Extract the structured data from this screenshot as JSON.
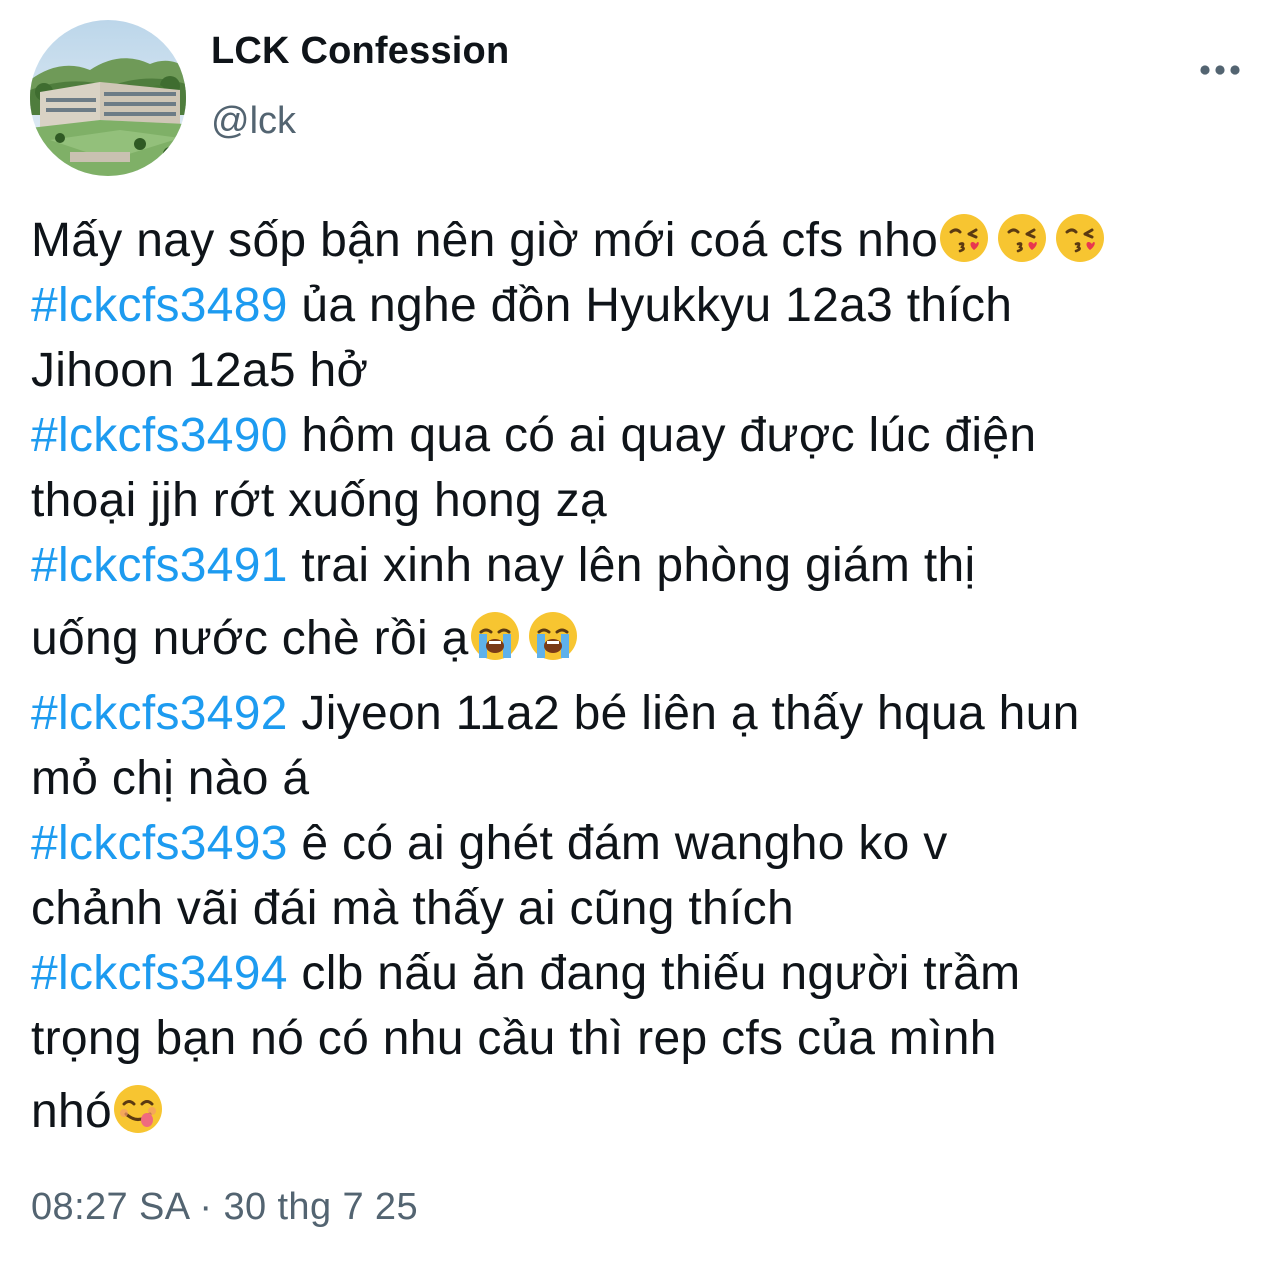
{
  "author": {
    "display_name": "LCK Confession",
    "handle": "@lck",
    "avatar_icon": "school-building-avatar"
  },
  "menu": {
    "icon": "more-horizontal-icon"
  },
  "tweet": {
    "intro": "Mấy nay sốp bận nên giờ mới coá cfs nho",
    "intro_emojis": [
      "face-blowing-kiss-emoji",
      "face-blowing-kiss-emoji",
      "face-blowing-kiss-emoji"
    ],
    "confessions": [
      {
        "tag": "#lckcfs3489",
        "line1": " ủa nghe đồn Hyukkyu 12a3 thích",
        "line2": "Jihoon 12a5 hở"
      },
      {
        "tag": "#lckcfs3490",
        "line1": " hôm qua có ai quay được lúc điện",
        "line2": "thoại jjh rớt xuống hong zạ"
      },
      {
        "tag": "#lckcfs3491",
        "line1": " trai xinh nay lên phòng giám thị",
        "line2": "uống nước chè rồi ạ",
        "emojis": [
          "loudly-crying-face-emoji",
          "loudly-crying-face-emoji"
        ]
      },
      {
        "tag": "#lckcfs3492",
        "line1": " Jiyeon 11a2 bé liên ạ thấy hqua hun",
        "line2": "mỏ chị nào á"
      },
      {
        "tag": "#lckcfs3493",
        "line1": " ê có ai ghét đám wangho ko v",
        "line2": "chảnh vãi đái mà thấy ai cũng thích"
      },
      {
        "tag": "#lckcfs3494",
        "line1": " clb nấu ăn đang thiếu người trầm",
        "line2": "trọng bạn nó có nhu cầu thì rep cfs của mình",
        "line3": "nhó",
        "emojis": [
          "face-savoring-food-emoji"
        ]
      }
    ]
  },
  "meta": {
    "time": "08:27 SA",
    "separator": " · ",
    "date": "30 thg 7 25"
  },
  "colors": {
    "hashtag": "#1d9bf0",
    "secondary_text": "#536471",
    "primary_text": "#0f1419"
  }
}
